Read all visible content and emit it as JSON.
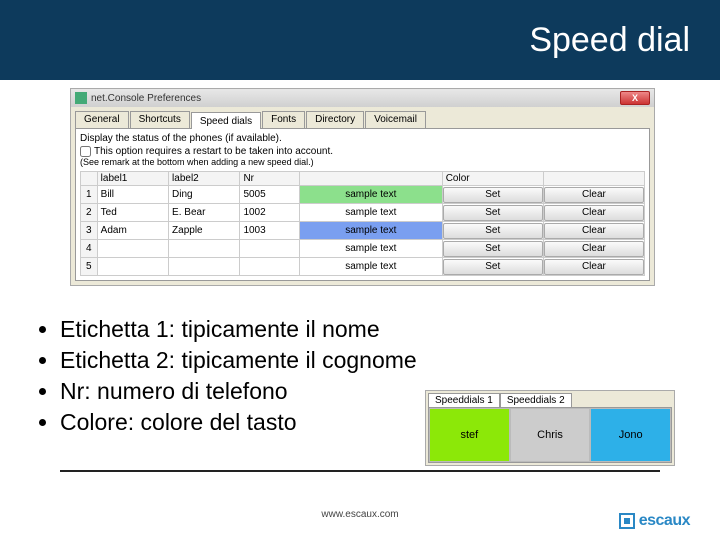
{
  "header": {
    "title": "Speed dial"
  },
  "window": {
    "title": "net.Console Preferences",
    "tabs": [
      "General",
      "Shortcuts",
      "Speed dials",
      "Fonts",
      "Directory",
      "Voicemail"
    ],
    "activeTab": 2,
    "desc": "Display the status of the phones (if available).",
    "checkbox": "This option requires a restart to be taken into account.",
    "note": "(See remark at the bottom when adding a new speed dial.)",
    "headers": [
      "label1",
      "label2",
      "Nr",
      "",
      "Color",
      ""
    ],
    "rows": [
      {
        "n": "1",
        "l1": "Bill",
        "l2": "Ding",
        "nr": "5005",
        "sample": "sample text",
        "cls": "green",
        "b1": "Set",
        "b2": "Clear"
      },
      {
        "n": "2",
        "l1": "Ted",
        "l2": "E. Bear",
        "nr": "1002",
        "sample": "sample text",
        "cls": "",
        "b1": "Set",
        "b2": "Clear"
      },
      {
        "n": "3",
        "l1": "Adam",
        "l2": "Zapple",
        "nr": "1003",
        "sample": "sample text",
        "cls": "blue",
        "b1": "Set",
        "b2": "Clear"
      },
      {
        "n": "4",
        "l1": "",
        "l2": "",
        "nr": "",
        "sample": "sample text",
        "cls": "",
        "b1": "Set",
        "b2": "Clear"
      },
      {
        "n": "5",
        "l1": "",
        "l2": "",
        "nr": "",
        "sample": "sample text",
        "cls": "",
        "b1": "Set",
        "b2": "Clear"
      }
    ]
  },
  "bullets": [
    "Etichetta 1: tipicamente il nome",
    "Etichetta 2: tipicamente il cognome",
    "Nr: numero di telefono",
    "Colore: colore del tasto"
  ],
  "preview": {
    "tabs": [
      "Speeddials 1",
      "Speeddials 2"
    ],
    "cells": [
      {
        "label": "stef",
        "cls": "g"
      },
      {
        "label": "Chris",
        "cls": "gray"
      },
      {
        "label": "Jono",
        "cls": "b"
      }
    ]
  },
  "footer": {
    "url": "www.escaux.com",
    "brand": "escaux"
  }
}
